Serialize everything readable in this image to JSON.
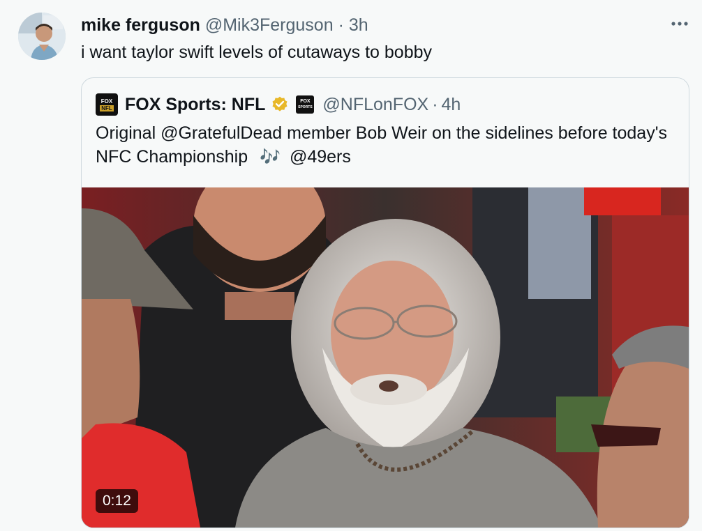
{
  "tweet": {
    "author_name": "mike ferguson",
    "author_handle": "@Mik3Ferguson",
    "separator": "·",
    "time": "3h",
    "text": "i want taylor swift levels of cutaways to bobby",
    "more_icon": "more-icon"
  },
  "quote": {
    "author_name": "FOX Sports: NFL",
    "author_handle": "@NFLonFOX",
    "separator": "·",
    "time": "4h",
    "text_before": "Original @GratefulDead member Bob Weir on the sidelines before today's NFC Championship",
    "emoji": "🎶",
    "text_after": "@49ers",
    "logo_top": "FOX",
    "logo_bottom": "NFL",
    "small_logo_top": "FOX",
    "small_logo_bottom": "SPORTS",
    "verified_color": "#e8b829"
  },
  "video": {
    "duration": "0:12"
  }
}
